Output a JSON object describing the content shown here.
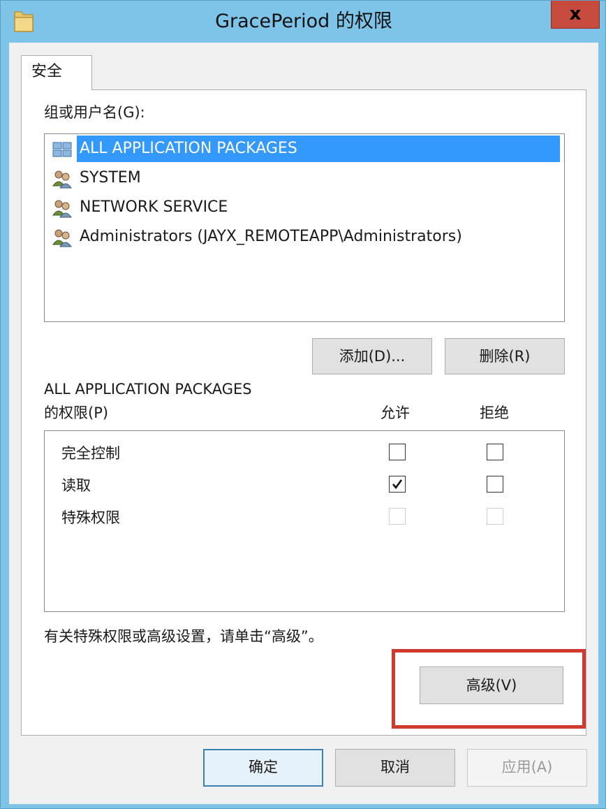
{
  "window": {
    "title": "GracePeriod 的权限",
    "close_label": "x"
  },
  "tabs": [
    {
      "label": "安全"
    }
  ],
  "groups": {
    "label": "组或用户名(G):",
    "items": [
      {
        "name": "ALL APPLICATION PACKAGES",
        "icon": "packages-icon",
        "selected": true
      },
      {
        "name": "SYSTEM",
        "icon": "users-icon"
      },
      {
        "name": "NETWORK SERVICE",
        "icon": "users-icon"
      },
      {
        "name": "Administrators (JAYX_REMOTEAPP\\Administrators)",
        "icon": "users-icon"
      }
    ],
    "add_button": "添加(D)...",
    "remove_button": "删除(R)"
  },
  "permissions": {
    "label_line1": "ALL APPLICATION PACKAGES",
    "label_line2": "的权限(P)",
    "allow_header": "允许",
    "deny_header": "拒绝",
    "rows": [
      {
        "name": "完全控制",
        "allow": false,
        "deny": false,
        "enabled": true
      },
      {
        "name": "读取",
        "allow": true,
        "deny": false,
        "enabled": true
      },
      {
        "name": "特殊权限",
        "allow": false,
        "deny": false,
        "enabled": false
      }
    ]
  },
  "advanced": {
    "hint": "有关特殊权限或高级设置，请单击“高级”。",
    "button": "高级(V)"
  },
  "footer": {
    "ok": "确定",
    "cancel": "取消",
    "apply": "应用(A)"
  },
  "colors": {
    "titlebar": "#7ec4e8",
    "selection": "#3399ff",
    "close": "#c74b3c",
    "highlight": "#d03a2e"
  }
}
